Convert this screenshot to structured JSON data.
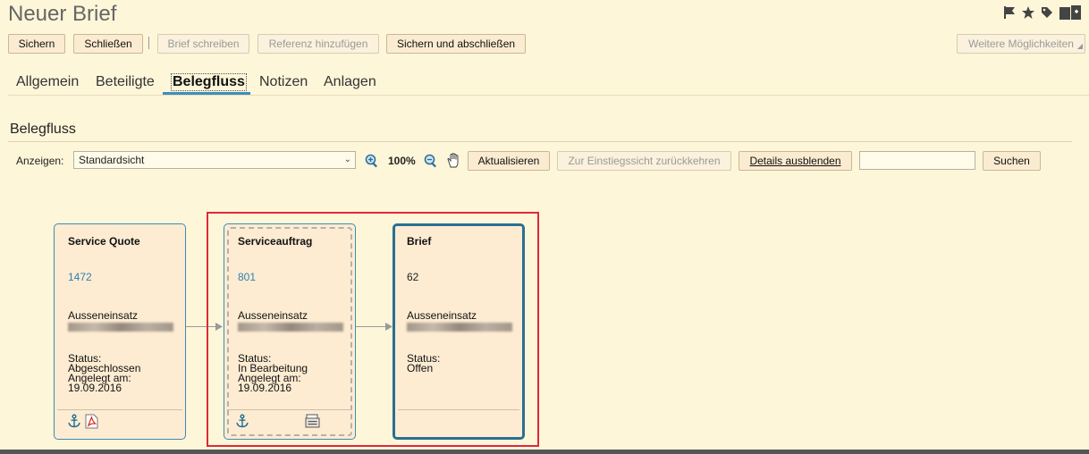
{
  "window": {
    "title": "Neuer Brief"
  },
  "header_icons": [
    "flag-icon",
    "star-icon",
    "tag-icon",
    "add-window-icon"
  ],
  "toolbar": {
    "save": "Sichern",
    "close": "Schließen",
    "write_letter": "Brief schreiben",
    "add_reference": "Referenz hinzufügen",
    "save_and_close": "Sichern und abschließen",
    "more": "Weitere Möglichkeiten"
  },
  "tabs": [
    {
      "label": "Allgemein",
      "active": false
    },
    {
      "label": "Beteiligte",
      "active": false
    },
    {
      "label": "Belegfluss",
      "active": true
    },
    {
      "label": "Notizen",
      "active": false
    },
    {
      "label": "Anlagen",
      "active": false
    }
  ],
  "section": {
    "title": "Belegfluss"
  },
  "flow_toolbar": {
    "show_label": "Anzeigen:",
    "view_value": "Standardsicht",
    "zoom": "100%",
    "refresh": "Aktualisieren",
    "back_to_entry": "Zur Einstiegssicht zurückkehren",
    "hide_details": "Details ausblenden",
    "search_value": "",
    "search": "Suchen"
  },
  "cards": [
    {
      "title": "Service Quote",
      "number": "1472",
      "type": "Ausseneinsatz",
      "status_label": "Status:",
      "status": "Abgeschlossen",
      "created_label": "Angelegt am:",
      "created": "19.09.2016",
      "icons": [
        "anchor-icon",
        "pdf-icon"
      ]
    },
    {
      "title": "Serviceauftrag",
      "number": "801",
      "type": "Ausseneinsatz",
      "status_label": "Status:",
      "status": "In Bearbeitung",
      "created_label": "Angelegt am:",
      "created": "19.09.2016",
      "icons": [
        "anchor-icon",
        "document-stack-icon"
      ]
    },
    {
      "title": "Brief",
      "number": "62",
      "type": "Ausseneinsatz",
      "status_label": "Status:",
      "status": "Offen",
      "icons": []
    }
  ],
  "colors": {
    "background": "#fdf6d8",
    "accent": "#3a8fbf",
    "highlight": "#e0283a"
  }
}
